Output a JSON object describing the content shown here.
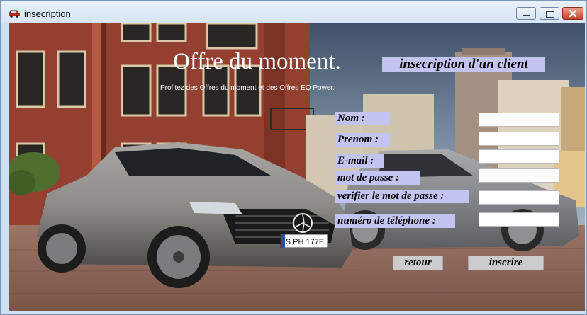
{
  "window": {
    "title": "insecription",
    "icon": "car-icon",
    "controls": [
      "minimize-icon",
      "maximize-icon",
      "close-icon"
    ]
  },
  "promo": {
    "headline": "Offre du moment.",
    "subline": "Profitez des Offres du moment et des Offres EQ Power.",
    "plate": "S PH 177E"
  },
  "form": {
    "title": "insecription d'un client",
    "fields": [
      {
        "label": "Nom :",
        "value": ""
      },
      {
        "label": "Prenom :",
        "value": ""
      },
      {
        "label": "E-mail :",
        "value": ""
      },
      {
        "label": "mot de passe  :",
        "value": ""
      },
      {
        "label": "verifier le mot de passe :",
        "value": ""
      },
      {
        "label": "numéro de téléphone :",
        "value": ""
      }
    ],
    "buttons": {
      "back": "retour",
      "submit": "inscrire"
    }
  },
  "colors": {
    "label_bg": "#c3c3ef",
    "button_bg": "#cbcbcb",
    "titlebar": "#dce8f6"
  }
}
